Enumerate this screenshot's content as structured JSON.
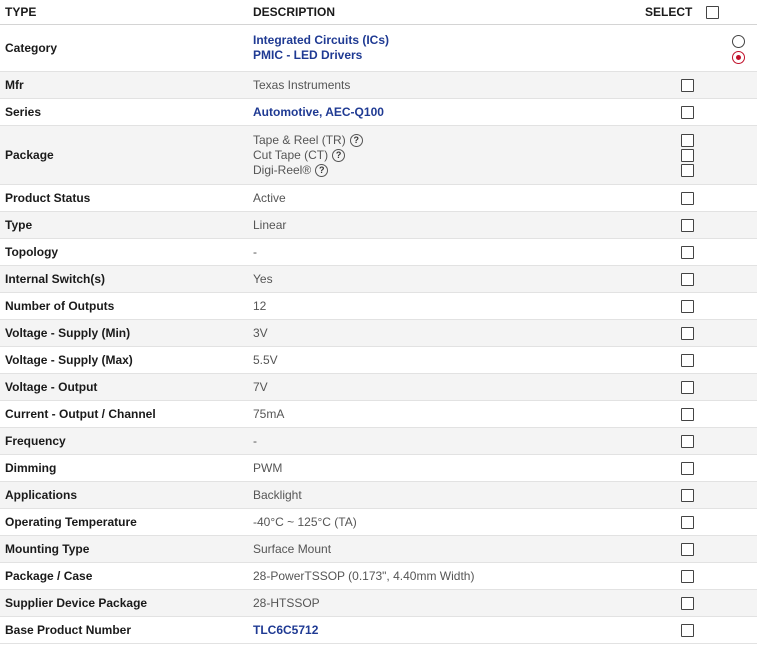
{
  "header": {
    "type_label": "TYPE",
    "description_label": "DESCRIPTION",
    "select_label": "SELECT"
  },
  "colors": {
    "link": "#1f3a93",
    "radio_selected": "#c0102a",
    "row_alt": "#f4f4f4"
  },
  "rows": [
    {
      "type": "Category",
      "values": [
        "Integrated Circuits (ICs)",
        "PMIC - LED Drivers"
      ],
      "link": true,
      "control": "radio",
      "selected_index": 1
    },
    {
      "type": "Mfr",
      "values": [
        "Texas Instruments"
      ]
    },
    {
      "type": "Series",
      "values": [
        "Automotive, AEC-Q100"
      ],
      "link": true
    },
    {
      "type": "Package",
      "values": [
        "Tape & Reel (TR)",
        "Cut Tape (CT)",
        "Digi-Reel®"
      ],
      "help_icons": true
    },
    {
      "type": "Product Status",
      "values": [
        "Active"
      ]
    },
    {
      "type": "Type",
      "values": [
        "Linear"
      ]
    },
    {
      "type": "Topology",
      "values": [
        "-"
      ]
    },
    {
      "type": "Internal Switch(s)",
      "values": [
        "Yes"
      ]
    },
    {
      "type": "Number of Outputs",
      "values": [
        "12"
      ]
    },
    {
      "type": "Voltage - Supply (Min)",
      "values": [
        "3V"
      ]
    },
    {
      "type": "Voltage - Supply (Max)",
      "values": [
        "5.5V"
      ]
    },
    {
      "type": "Voltage - Output",
      "values": [
        "7V"
      ]
    },
    {
      "type": "Current - Output / Channel",
      "values": [
        "75mA"
      ]
    },
    {
      "type": "Frequency",
      "values": [
        "-"
      ]
    },
    {
      "type": "Dimming",
      "values": [
        "PWM"
      ]
    },
    {
      "type": "Applications",
      "values": [
        "Backlight"
      ]
    },
    {
      "type": "Operating Temperature",
      "values": [
        "-40°C ~ 125°C (TA)"
      ]
    },
    {
      "type": "Mounting Type",
      "values": [
        "Surface Mount"
      ]
    },
    {
      "type": "Package / Case",
      "values": [
        "28-PowerTSSOP (0.173\", 4.40mm Width)"
      ]
    },
    {
      "type": "Supplier Device Package",
      "values": [
        "28-HTSSOP"
      ]
    },
    {
      "type": "Base Product Number",
      "values": [
        "TLC6C5712"
      ],
      "link": true
    }
  ]
}
